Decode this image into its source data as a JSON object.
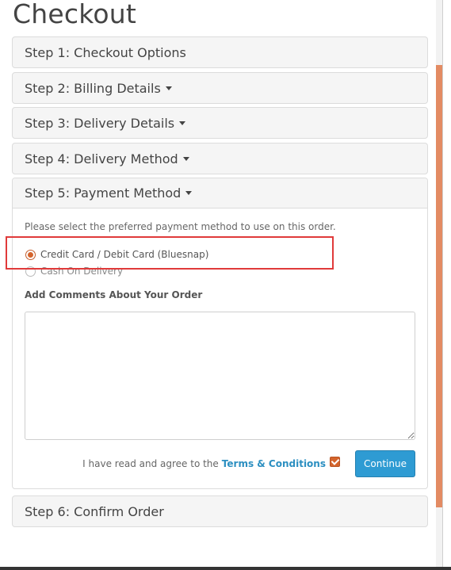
{
  "page": {
    "title": "Checkout"
  },
  "steps": [
    {
      "label": "Step 1: Checkout Options",
      "has_caret": false
    },
    {
      "label": "Step 2: Billing Details",
      "has_caret": true
    },
    {
      "label": "Step 3: Delivery Details",
      "has_caret": true
    },
    {
      "label": "Step 4: Delivery Method",
      "has_caret": true
    },
    {
      "label": "Step 5: Payment Method",
      "has_caret": true,
      "open": true
    },
    {
      "label": "Step 6: Confirm Order",
      "has_caret": false
    }
  ],
  "payment": {
    "instruction": "Please select the preferred payment method to use on this order.",
    "options": [
      {
        "label": "Credit Card / Debit Card (Bluesnap)",
        "selected": true
      },
      {
        "label": "Cash On Delivery",
        "selected": false
      }
    ],
    "comments_label": "Add Comments About Your Order",
    "comments_value": "",
    "agree_text": "I have read and agree to the",
    "terms_link": "Terms & Conditions",
    "agree_checked": true,
    "continue_label": "Continue"
  },
  "colors": {
    "accent": "#d4642c",
    "button": "#2e9bd3",
    "link": "#2c8fc1",
    "highlight": "#e03a3a"
  }
}
